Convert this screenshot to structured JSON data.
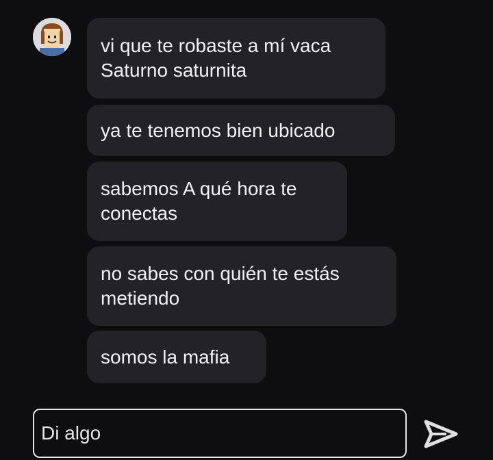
{
  "messages": [
    {
      "text_line1": "vi que te robaste a mí vaca",
      "text_line2": "Saturno saturnita"
    },
    {
      "text_line1": "ya te tenemos bien ubicado"
    },
    {
      "text_line1": "sabemos A qué hora te",
      "text_line2": "conectas"
    },
    {
      "text_line1": "no sabes con quién te estás",
      "text_line2": "metiendo"
    },
    {
      "text_line1": "somos la mafia"
    }
  ],
  "composer": {
    "placeholder": "Di algo"
  },
  "icons": {
    "avatar": "avatar-icon",
    "send": "send-icon"
  },
  "colors": {
    "background": "#0e0e10",
    "bubble": "#232327",
    "text": "#f1f1f3",
    "send_icon": "#e0e0e2"
  }
}
